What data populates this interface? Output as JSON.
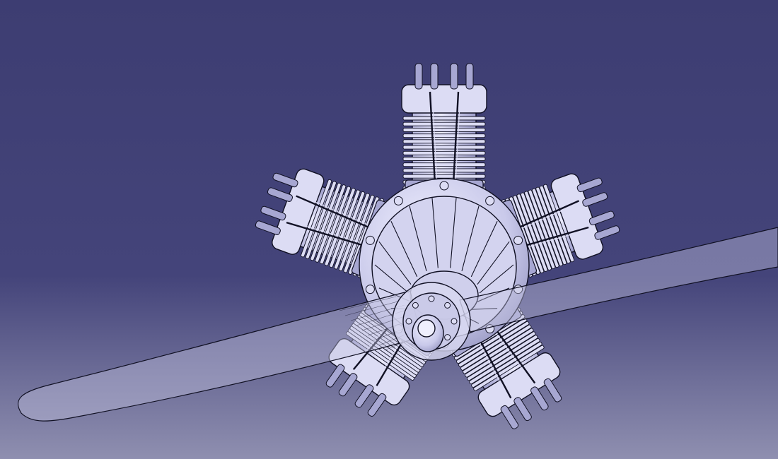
{
  "viewport": {
    "background_top": "#3d3d72",
    "background_bottom": "#8f8fb0",
    "model_fill": "#dcdcf4",
    "model_shade": "#a7a7d2",
    "model_dark": "#6f6fa3",
    "edge_color": "#111124",
    "propeller_fill": "#c4c4e0",
    "propeller_opacity": 0.42,
    "cylinder_count": 5,
    "propeller_blade_count": 2
  }
}
